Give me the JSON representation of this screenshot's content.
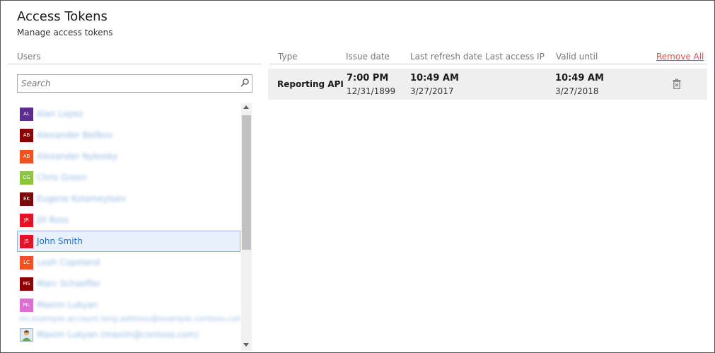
{
  "header": {
    "title": "Access Tokens",
    "subtitle": "Manage access tokens"
  },
  "users_panel": {
    "label": "Users",
    "search_placeholder": "Search",
    "users": [
      {
        "initials": "AL",
        "color": "#5c2d91",
        "name": "Alan Lopez",
        "blurred": true
      },
      {
        "initials": "AB",
        "color": "#8b0000",
        "name": "Alexander Bellkov",
        "blurred": true
      },
      {
        "initials": "AB",
        "color": "#f25022",
        "name": "Alexander Nykosky",
        "blurred": true
      },
      {
        "initials": "CG",
        "color": "#8cc63f",
        "name": "Chris Green",
        "blurred": true
      },
      {
        "initials": "EK",
        "color": "#7a0a0a",
        "name": "Eugene Kolomeytsev",
        "blurred": true
      },
      {
        "initials": "JR",
        "color": "#e81123",
        "name": "Jill Ross",
        "blurred": true
      },
      {
        "initials": "JS",
        "color": "#e81123",
        "name": "John Smith",
        "selected": true
      },
      {
        "initials": "LC",
        "color": "#f25022",
        "name": "Leah Copeland",
        "blurred": true
      },
      {
        "initials": "MS",
        "color": "#8b0000",
        "name": "Marc Schaeffer",
        "blurred": true
      },
      {
        "initials": "ML",
        "color": "#da70d6",
        "name": "Maxim Lukyan",
        "blurred": true,
        "email": "ml.example.account.long.address@example.contoso.com"
      },
      {
        "initials": "",
        "color": "#dfe9f2",
        "name": "Maxim Lukyan (maxim@contoso.com)",
        "blurred": true,
        "photo": true
      }
    ]
  },
  "tokens_panel": {
    "columns": {
      "type": "Type",
      "issue_date": "Issue date",
      "last_refresh_date": "Last refresh date",
      "last_access_ip": "Last access IP",
      "valid_until": "Valid until"
    },
    "remove_all_label": "Remove All",
    "tokens": [
      {
        "type": "Reporting API",
        "issue_time": "7:00 PM",
        "issue_date": "12/31/1899",
        "refresh_time": "10:49 AM",
        "refresh_date": "3/27/2017",
        "last_access_ip": "",
        "valid_time": "10:49 AM",
        "valid_date": "3/27/2018"
      }
    ]
  },
  "icons": {
    "search": "magnifier-icon",
    "delete": "trash-icon"
  }
}
